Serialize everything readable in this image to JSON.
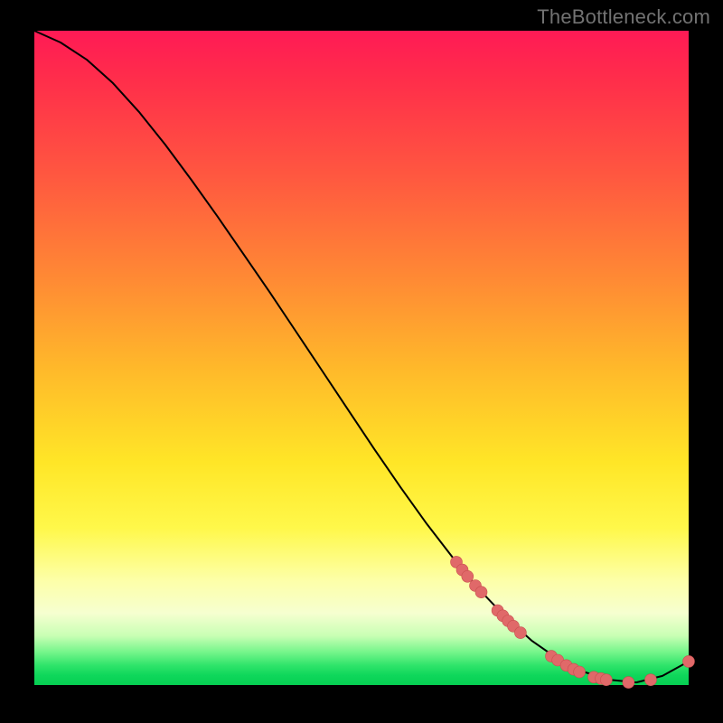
{
  "watermark": "TheBottleneck.com",
  "colors": {
    "curve_stroke": "#000000",
    "marker_fill": "#e06969",
    "marker_stroke": "#c94f4f"
  },
  "chart_data": {
    "type": "line",
    "title": "",
    "xlabel": "",
    "ylabel": "",
    "xlim": [
      0,
      100
    ],
    "ylim": [
      0,
      100
    ],
    "grid": false,
    "legend": false,
    "series": [
      {
        "name": "bottleneck-curve",
        "x": [
          0,
          4,
          8,
          12,
          16,
          20,
          24,
          28,
          32,
          36,
          40,
          44,
          48,
          52,
          56,
          60,
          64,
          68,
          72,
          76,
          80,
          84,
          88,
          92,
          96,
          100
        ],
        "y": [
          100,
          98.2,
          95.6,
          92.0,
          87.6,
          82.6,
          77.2,
          71.6,
          65.8,
          60.0,
          54.0,
          48.0,
          42.0,
          36.0,
          30.2,
          24.6,
          19.4,
          14.6,
          10.4,
          6.8,
          4.0,
          2.0,
          0.8,
          0.4,
          1.4,
          3.6
        ]
      }
    ],
    "markers": [
      {
        "x": 64.5,
        "y": 18.8
      },
      {
        "x": 65.4,
        "y": 17.6
      },
      {
        "x": 66.2,
        "y": 16.6
      },
      {
        "x": 67.4,
        "y": 15.2
      },
      {
        "x": 68.3,
        "y": 14.2
      },
      {
        "x": 70.8,
        "y": 11.4
      },
      {
        "x": 71.6,
        "y": 10.6
      },
      {
        "x": 72.4,
        "y": 9.8
      },
      {
        "x": 73.2,
        "y": 9.0
      },
      {
        "x": 74.3,
        "y": 8.0
      },
      {
        "x": 79.0,
        "y": 4.4
      },
      {
        "x": 80.0,
        "y": 3.8
      },
      {
        "x": 81.3,
        "y": 3.0
      },
      {
        "x": 82.4,
        "y": 2.4
      },
      {
        "x": 83.3,
        "y": 2.0
      },
      {
        "x": 85.5,
        "y": 1.2
      },
      {
        "x": 86.6,
        "y": 1.0
      },
      {
        "x": 87.4,
        "y": 0.8
      },
      {
        "x": 90.8,
        "y": 0.4
      },
      {
        "x": 94.2,
        "y": 0.8
      },
      {
        "x": 100.0,
        "y": 3.6
      }
    ]
  }
}
